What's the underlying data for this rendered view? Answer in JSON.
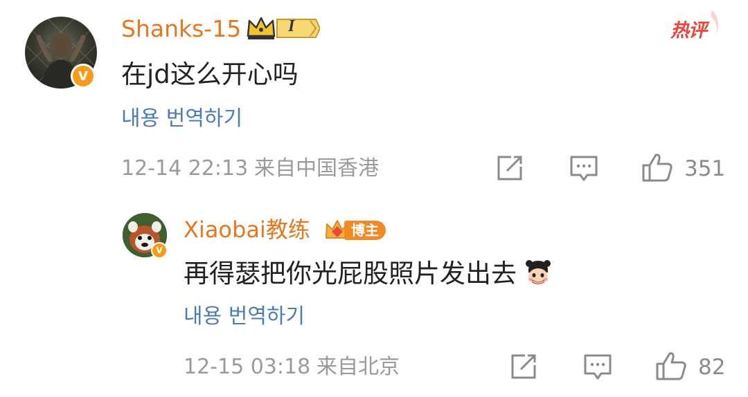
{
  "hot_tag": "热评",
  "comment": {
    "username": "Shanks-15",
    "vip_level": "I",
    "verified_mark": "V",
    "text": "在jd这么开心吗",
    "translate_label": "내용 번역하기",
    "timestamp": "12-14 22:13",
    "location": "来自中国香港",
    "like_count": "351"
  },
  "reply": {
    "username": "Xiaobai教练",
    "badge": "博主",
    "verified_mark": "V",
    "text": "再得瑟把你光屁股照片发出去",
    "translate_label": "내용 번역하기",
    "timestamp": "12-15 03:18",
    "location": "来自北京",
    "like_count": "82"
  },
  "colors": {
    "username": "#e8761e",
    "link": "#4a7bb5",
    "meta": "#9a9a9a",
    "hot_tag": "#e8453c",
    "verified": "#f59c1c"
  },
  "icons": [
    "share-icon",
    "comment-icon",
    "like-icon",
    "emoji-icon",
    "crown-icon"
  ]
}
